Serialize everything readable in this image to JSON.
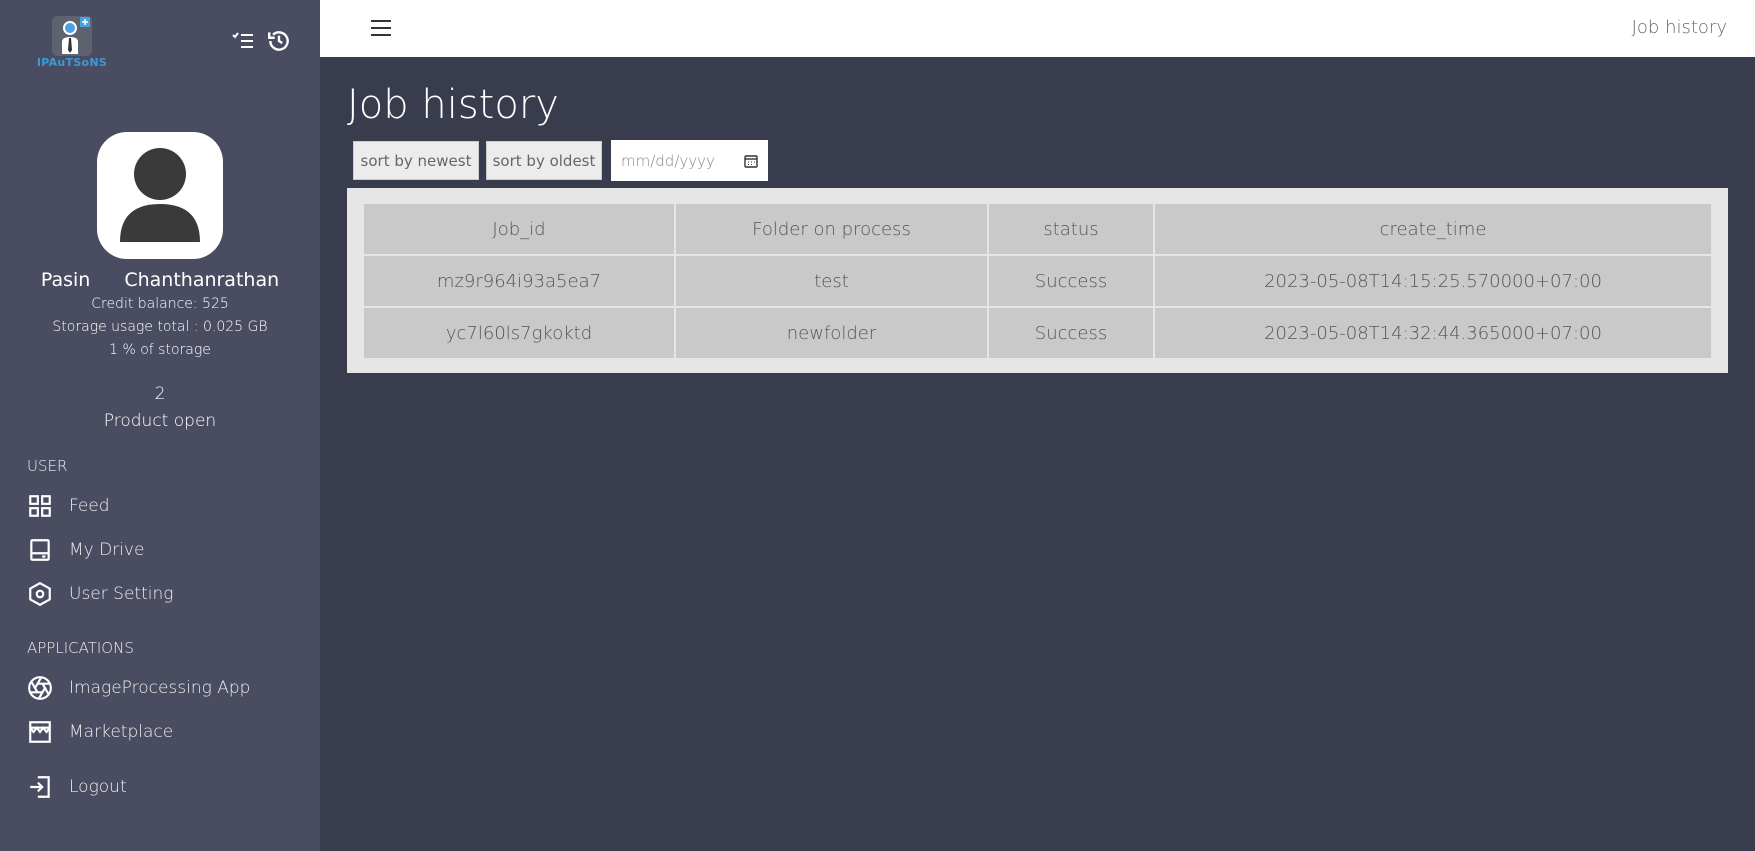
{
  "app": {
    "logo_text": "IPAuTSoNS"
  },
  "profile": {
    "first_name": "Pasin",
    "last_name": "Chanthanrathan",
    "credit": "Credit balance: 525",
    "storage": "Storage usage total : 0.025 GB",
    "storage_percent": "1 % of storage",
    "product_count": "2",
    "product_label": "Product open"
  },
  "sidebar": {
    "user_section": "USER",
    "user_items": [
      {
        "label": "Feed",
        "icon": "grid-icon"
      },
      {
        "label": "My Drive",
        "icon": "drive-icon"
      },
      {
        "label": "User Setting",
        "icon": "hexagon-settings-icon"
      }
    ],
    "apps_section": "APPLICATIONS",
    "app_items": [
      {
        "label": "ImageProcessing App",
        "icon": "aperture-icon"
      },
      {
        "label": "Marketplace",
        "icon": "store-icon"
      }
    ],
    "logout": "Logout"
  },
  "header": {
    "breadcrumb": "Job history"
  },
  "main": {
    "title": "Job history",
    "sort_newest": "sort by newest",
    "sort_oldest": "sort by oldest",
    "date_placeholder": "mm/dd/yyyy",
    "table": {
      "headers": [
        "Job_id",
        "Folder on process",
        "status",
        "create_time"
      ],
      "rows": [
        [
          "mz9r964i93a5ea7",
          "test",
          "Success",
          "2023-05-08T14:15:25.570000+07:00"
        ],
        [
          "yc7l60ls7gkoktd",
          "newfolder",
          "Success",
          "2023-05-08T14:32:44.365000+07:00"
        ]
      ]
    }
  },
  "colors": {
    "sidebar": "#4a4d62",
    "main": "#393c4c",
    "logo": "#3a9ad9"
  }
}
